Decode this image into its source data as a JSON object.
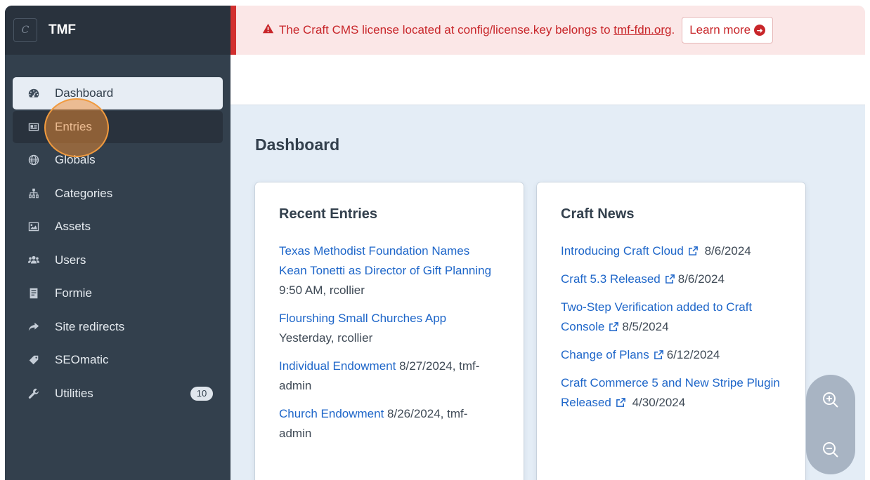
{
  "site": {
    "logo_letter": "C",
    "name": "TMF"
  },
  "nav": [
    {
      "label": "Dashboard",
      "icon": "gauge-icon",
      "active": true
    },
    {
      "label": "Entries",
      "icon": "newspaper-icon",
      "hover": true
    },
    {
      "label": "Globals",
      "icon": "globe-icon"
    },
    {
      "label": "Categories",
      "icon": "sitemap-icon"
    },
    {
      "label": "Assets",
      "icon": "image-icon"
    },
    {
      "label": "Users",
      "icon": "users-icon"
    },
    {
      "label": "Formie",
      "icon": "form-icon"
    },
    {
      "label": "Site redirects",
      "icon": "share-arrow-icon"
    },
    {
      "label": "SEOmatic",
      "icon": "tag-icon"
    },
    {
      "label": "Utilities",
      "icon": "wrench-icon",
      "badge": "10"
    }
  ],
  "alert": {
    "icon": "warning-icon",
    "text": "The Craft CMS license located at config/license.key belongs to",
    "link": "tmf-fdn.org",
    "after": ".",
    "button": "Learn more"
  },
  "page_title": "Dashboard",
  "recent_entries": {
    "title": "Recent Entries",
    "items": [
      {
        "link": "Texas Methodist Foundation Names Kean Tonetti as Director of Gift Planning",
        "meta": "9:50 AM, rcollier"
      },
      {
        "link": "Flourshing Small Churches App",
        "meta": "Yesterday, rcollier"
      },
      {
        "link": "Individual Endowment",
        "meta": "8/27/2024, tmf-admin"
      },
      {
        "link": "Church Endowment",
        "meta": "8/26/2024, tmf-admin"
      }
    ]
  },
  "craft_news": {
    "title": "Craft News",
    "items": [
      {
        "link": "Introducing Craft Cloud",
        "date": "8/6/2024"
      },
      {
        "link": "Craft 5.3 Released",
        "date": "8/6/2024"
      },
      {
        "link": "Two-Step Verification added to Craft Console",
        "date": "8/5/2024"
      },
      {
        "link": "Change of Plans",
        "date": "6/12/2024"
      },
      {
        "link": "Craft Commerce 5 and New Stripe Plugin Released",
        "date": "4/30/2024"
      }
    ]
  },
  "colors": {
    "sidebar": "#33404d",
    "sidebar_header": "#29323d",
    "link": "#1e66c9",
    "alert": "#c8262a"
  },
  "zoom": {
    "in_icon": "zoom-in-icon",
    "out_icon": "zoom-out-icon"
  }
}
